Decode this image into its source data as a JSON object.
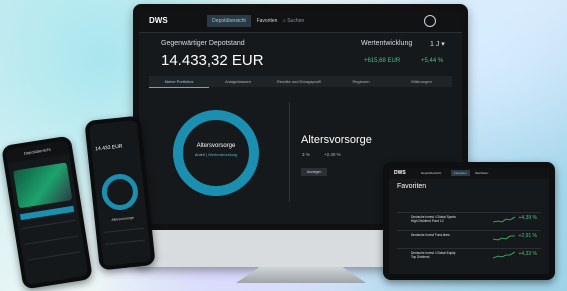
{
  "colors": {
    "accent": "#1b8fb0",
    "positive": "#4cc17a",
    "panel": "#16191c"
  },
  "desktop": {
    "logo": "DWS",
    "nav": [
      {
        "label": "Depotübersicht",
        "active": true
      },
      {
        "label": "Favoriten",
        "active": false
      }
    ],
    "search_placeholder": "Suchen",
    "user_icon": "user-circle-icon",
    "deposit_label": "Gegenwärtiger Depotstand",
    "deposit_value": "14.433,32 EUR",
    "development_label": "Wertentwicklung",
    "period": "1 J",
    "change_abs": "+615,68 EUR",
    "change_pct": "+5,44 %",
    "tabs": [
      {
        "label": "Meine Portfolios",
        "active": true
      },
      {
        "label": "Anlageklassen",
        "active": false
      },
      {
        "label": "Rendite und Ertragsprofil",
        "active": false
      },
      {
        "label": "Regionen",
        "active": false
      },
      {
        "label": "Währungen",
        "active": false
      }
    ],
    "ring_title": "Altersvorsorge",
    "ring_sub_left": "Anteil",
    "ring_sub_right": "Wertentwicklung",
    "detail_title": "Altersvorsorge",
    "detail_pct": "3 %",
    "detail_change": "+2,40 %",
    "detail_button": "Anzeigen"
  },
  "tablet": {
    "logo": "DWS",
    "nav": [
      "Depotübersicht",
      "Favoriten",
      "Wertlisten"
    ],
    "title": "Favoriten",
    "rows": [
      {
        "name": "Deutsche Invest I Global Sports High Dividend Fund LC",
        "change": "+4,39 %"
      },
      {
        "name": "Deutsche Invest Fund-lines",
        "change": "+2,91 %"
      },
      {
        "name": "Deutsche Invest I Global Equity Top Dividend",
        "change": "+4,33 %"
      }
    ]
  },
  "phone_left": {
    "header": "Depotübersicht"
  },
  "phone_right": {
    "value": "14.433 EUR",
    "ring_label": "Altersvorsorge"
  }
}
